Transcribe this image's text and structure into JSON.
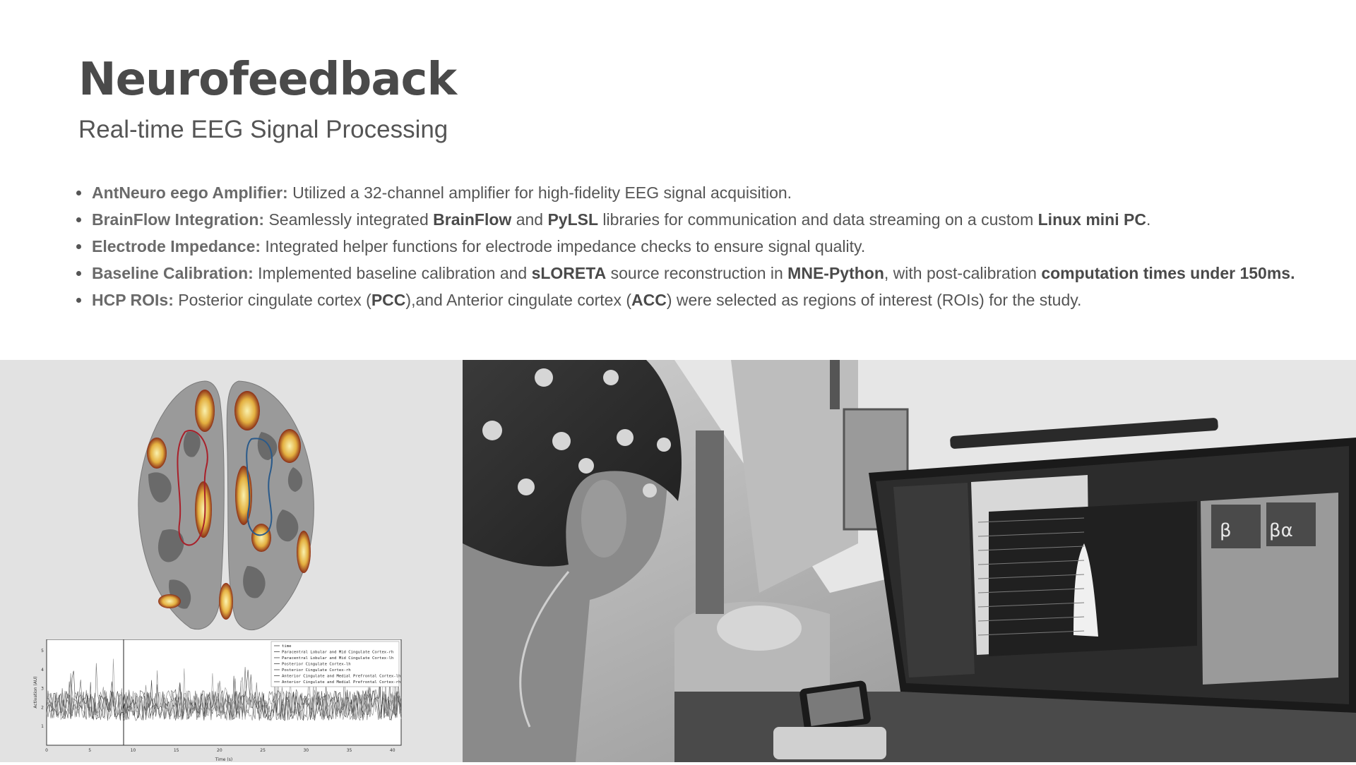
{
  "header": {
    "title": "Neurofeedback",
    "subtitle": "Real-time EEG Signal Processing"
  },
  "bullets": [
    {
      "label": "AntNeuro eego Amplifier:",
      "parts": [
        " Utilized a 32-channel amplifier for high-fidelity EEG signal acquisition."
      ]
    },
    {
      "label": "BrainFlow Integration:",
      "parts": [
        " Seamlessly integrated ",
        "BrainFlow",
        " and ",
        "PyLSL",
        " libraries for communication and data streaming on a custom ",
        "Linux mini PC",
        "."
      ]
    },
    {
      "label": "Electrode Impedance:",
      "parts": [
        " Integrated helper functions for electrode impedance checks to ensure signal quality."
      ]
    },
    {
      "label": "Baseline Calibration:",
      "parts": [
        " Implemented baseline calibration and ",
        "sLORETA",
        " source reconstruction in ",
        "MNE-Python",
        ", with post-calibration ",
        "computation times under 150ms",
        "."
      ]
    },
    {
      "label": "HCP ROIs:",
      "parts": [
        " Posterior cingulate cortex (",
        "PCC",
        "),and Anterior cingulate cortex (",
        "ACC",
        ") were selected as regions of interest (ROIs) for the study."
      ]
    }
  ],
  "figures": {
    "plot": {
      "legend": [
        "time",
        "Paracentral Lobular and Mid Cingulate Cortex-rh",
        "Paracentral Lobular and Mid Cingulate Cortex-lh",
        "Posterior Cingulate Cortex-lh",
        "Posterior Cingulate Cortex-rh",
        "Anterior Cingulate and Medial Prefrontal Cortex-lh",
        "Anterior Cingulate and Medial Prefrontal Cortex-rh"
      ],
      "ylabel": "Activation (AU)",
      "xlabel": "Time (s)",
      "xticks": [
        "0",
        "5",
        "10",
        "15",
        "20",
        "25",
        "30",
        "35",
        "40"
      ],
      "yticks": [
        "1",
        "2",
        "3",
        "4",
        "5"
      ]
    },
    "photo": {
      "screen_labels": [
        "β",
        "βα"
      ]
    }
  }
}
